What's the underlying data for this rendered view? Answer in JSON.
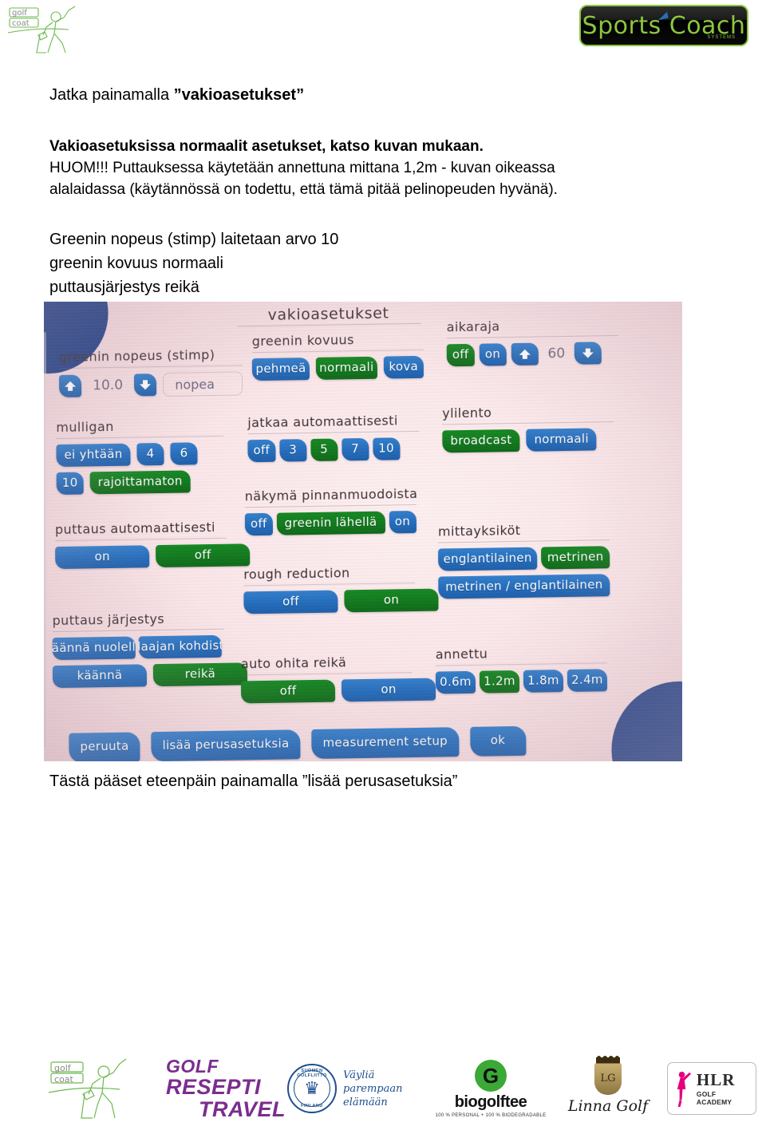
{
  "header": {
    "brand_left": {
      "line1": "golf",
      "line2": "coat",
      "icon": "golfer-swing-icon"
    },
    "brand_right": {
      "text": "Sports Coach",
      "subtext": "SYSTEMS"
    }
  },
  "doc": {
    "lead_plain": "Jatka painamalla ",
    "lead_quoted": "”vakioasetukset”",
    "para_bold": "Vakioasetuksissa normaalit asetukset, katso kuvan mukaan.",
    "para_line2": "HUOM!!! Puttauksessa käytetään annettuna mittana 1,2m - kuvan oikeassa",
    "para_line3": "alalaidassa (käytännössä on todettu, että tämä pitää pelinopeuden hyvänä).",
    "list_line1": "Greenin nopeus (stimp) laitetaan arvo 10",
    "list_line2": "greenin kovuus normaali",
    "list_line3": "puttausjärjestys reikä"
  },
  "caption": "Tästä pääset eteenpäin painamalla ”lisää perusasetuksia”",
  "screen": {
    "title": "vakioasetukset",
    "colors": {
      "selected": "#0d7a1a",
      "unselected": "#1f6cc0",
      "screen_bg": "#fbe6e9"
    },
    "groups": [
      {
        "label": "greenin nopeus (stimp)",
        "type": "stepper",
        "value": "10.0",
        "up_icon": "arrow-up-icon",
        "down_icon": "arrow-down-icon",
        "side_label": "nopea"
      },
      {
        "label": "greenin kovuus",
        "options": [
          {
            "label": "pehmeä",
            "selected": false
          },
          {
            "label": "normaali",
            "selected": true
          },
          {
            "label": "kova",
            "selected": false
          }
        ]
      },
      {
        "label": "aikaraja",
        "options": [
          {
            "label": "off",
            "selected": true
          },
          {
            "label": "on",
            "selected": false
          }
        ],
        "stepper_value": "60",
        "up_icon": "arrow-up-icon",
        "down_icon": "arrow-down-icon"
      },
      {
        "label": "mulligan",
        "options": [
          {
            "label": "ei yhtään",
            "selected": false
          },
          {
            "label": "4",
            "selected": false
          },
          {
            "label": "6",
            "selected": false
          },
          {
            "label": "10",
            "selected": false
          },
          {
            "label": "rajoittamaton",
            "selected": true
          }
        ]
      },
      {
        "label": "jatkaa automaattisesti",
        "options": [
          {
            "label": "off",
            "selected": false
          },
          {
            "label": "3",
            "selected": false
          },
          {
            "label": "5",
            "selected": true
          },
          {
            "label": "7",
            "selected": false
          },
          {
            "label": "10",
            "selected": false
          }
        ]
      },
      {
        "label": "ylilento",
        "options": [
          {
            "label": "broadcast",
            "selected": true
          },
          {
            "label": "normaali",
            "selected": false
          }
        ]
      },
      {
        "label": "näkymä pinnanmuodoista",
        "options": [
          {
            "label": "off",
            "selected": false
          },
          {
            "label": "greenin lähellä",
            "selected": true
          },
          {
            "label": "on",
            "selected": false
          }
        ]
      },
      {
        "label": "puttaus automaattisesti",
        "options": [
          {
            "label": "on",
            "selected": false
          },
          {
            "label": "off",
            "selected": true
          }
        ]
      },
      {
        "label": "rough reduction",
        "options": [
          {
            "label": "off",
            "selected": false
          },
          {
            "label": "on",
            "selected": true
          }
        ]
      },
      {
        "label": "mittayksiköt",
        "options": [
          {
            "label": "englantilainen",
            "selected": false
          },
          {
            "label": "metrinen",
            "selected": true
          },
          {
            "label": "metrinen / englantilainen",
            "selected": false
          }
        ]
      },
      {
        "label": "puttaus järjestys",
        "options": [
          {
            "label": "käännä nuolella",
            "selected": false
          },
          {
            "label": "pelaajan kohdistus",
            "selected": false
          },
          {
            "label": "käännä",
            "selected": false
          },
          {
            "label": "reikä",
            "selected": true
          }
        ]
      },
      {
        "label": "auto ohita reikä",
        "options": [
          {
            "label": "off",
            "selected": true
          },
          {
            "label": "on",
            "selected": false
          }
        ]
      },
      {
        "label": "annettu",
        "options": [
          {
            "label": "0.6m",
            "selected": false
          },
          {
            "label": "1.2m",
            "selected": true
          },
          {
            "label": "1.8m",
            "selected": false
          },
          {
            "label": "2.4m",
            "selected": false
          }
        ]
      }
    ],
    "bottom_bar": [
      {
        "label": "peruuta"
      },
      {
        "label": "lisää perusasetuksia"
      },
      {
        "label": "measurement setup"
      },
      {
        "label": "ok"
      }
    ]
  },
  "footer": {
    "logos": [
      {
        "name": "golf-coat",
        "line1": "golf",
        "line2": "coat"
      },
      {
        "name": "golf-resepti-travel",
        "line1": "GOLF",
        "line2": "RESEPTI",
        "line3": "TRAVEL"
      },
      {
        "name": "suomen-golfliitto",
        "seal_top": "SUOMEN GOLFLIITTO",
        "seal_bottom": "FINLAND",
        "tag1": "Väyliä",
        "tag2": "parempaan",
        "tag3": "elämään"
      },
      {
        "name": "biogolftee",
        "title": "biogolftee",
        "sub": "100 % PERSONAL + 100 % BIODEGRADABLE",
        "mark": "G"
      },
      {
        "name": "linna-golf",
        "title": "Linna Golf",
        "crest": "LG"
      },
      {
        "name": "hlr-golf-academy",
        "title": "HLR",
        "sub": "GOLF ACADEMY"
      }
    ]
  }
}
